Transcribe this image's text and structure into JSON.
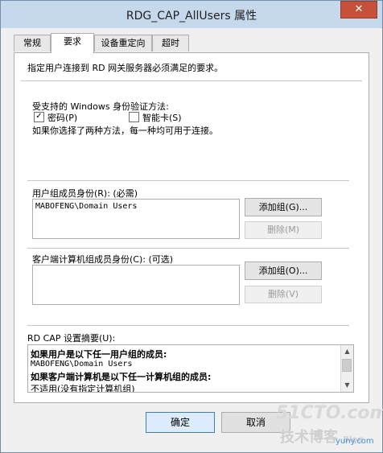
{
  "window": {
    "title": "RDG_CAP_AllUsers 属性",
    "close_glyph": "✕"
  },
  "tabs": [
    {
      "label": "常规"
    },
    {
      "label": "要求"
    },
    {
      "label": "设备重定向"
    },
    {
      "label": "超时"
    }
  ],
  "requirements": {
    "description": "指定用户连接到 RD 网关服务器必须满足的要求。",
    "auth_heading": "受支持的 Windows 身份验证方法:",
    "password_label": "密码(P)",
    "password_checked": "✓",
    "smartcard_label": "智能卡(S)",
    "auth_note": "如果你选择了两种方法，每一种均可用于连接。"
  },
  "user_groups": {
    "label": "用户组成员身份(R): (必需)",
    "items": [
      "MABOFENG\\Domain Users"
    ],
    "add_button": "添加组(G)...",
    "remove_button": "删除(M)"
  },
  "computer_groups": {
    "label": "客户端计算机组成员身份(C): (可选)",
    "items": [],
    "add_button": "添加组(O)...",
    "remove_button": "删除(V)"
  },
  "summary": {
    "label": "RD CAP 设置摘要(U):",
    "lines": [
      "如果用户是以下任一用户组的成员:",
      "MABOFENG\\Domain Users",
      "如果客户端计算机是以下任一计算机组的成员:",
      "不适用(没有指定计算机组)"
    ]
  },
  "buttons": {
    "ok": "确定",
    "cancel": "取消"
  },
  "watermark": {
    "line1": "51CTO.com",
    "line2": "技术博客",
    "line3": "Blog",
    "line4": "yuny.com"
  }
}
